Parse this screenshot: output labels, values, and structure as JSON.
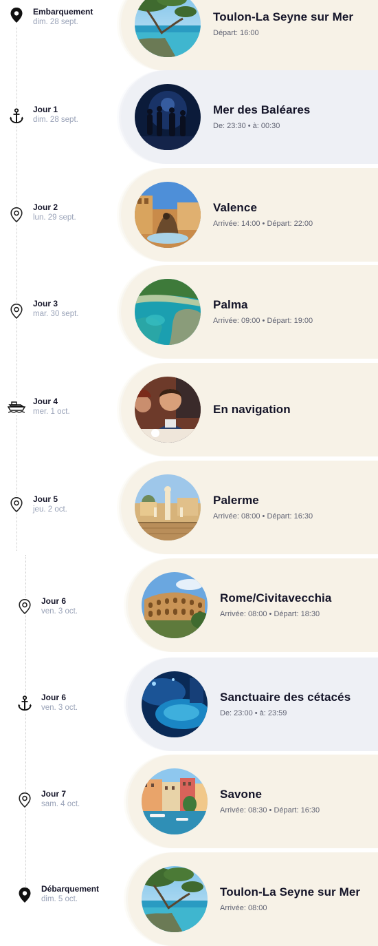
{
  "stops": [
    {
      "icon": "pin-filled",
      "kind": "port",
      "day": "Embarquement",
      "date": "dim. 28 sept.",
      "title": "Toulon-La Seyne sur Mer",
      "times": "Départ: 16:00",
      "photo": "coast-pine"
    },
    {
      "icon": "anchor",
      "kind": "sea",
      "day": "Jour 1",
      "date": "dim. 28 sept.",
      "title": "Mer des Baléares",
      "times": "De: 23:30 • à: 00:30",
      "photo": "night-show"
    },
    {
      "icon": "pin-outline",
      "kind": "port",
      "day": "Jour 2",
      "date": "lun. 29 sept.",
      "title": "Valence",
      "times": "Arrivée: 14:00 • Départ: 22:00",
      "photo": "valence"
    },
    {
      "icon": "pin-outline",
      "kind": "port",
      "day": "Jour 3",
      "date": "mar. 30 sept.",
      "title": "Palma",
      "times": "Arrivée: 09:00 • Départ: 19:00",
      "photo": "palma"
    },
    {
      "icon": "ship",
      "kind": "port",
      "day": "Jour 4",
      "date": "mer. 1 oct.",
      "title": "En navigation",
      "times": "",
      "photo": "dining"
    },
    {
      "icon": "pin-outline",
      "kind": "port",
      "day": "Jour 5",
      "date": "jeu. 2 oct.",
      "title": "Palerme",
      "times": "Arrivée: 08:00 • Départ: 16:30",
      "photo": "palerme"
    },
    {
      "icon": "pin-outline",
      "kind": "port",
      "day": "Jour 6",
      "date": "ven. 3 oct.",
      "title": "Rome/Civitavecchia",
      "times": "Arrivée: 08:00 • Départ: 18:30",
      "photo": "colosseum"
    },
    {
      "icon": "anchor",
      "kind": "sea",
      "day": "Jour 6",
      "date": "ven. 3 oct.",
      "title": "Sanctuaire des cétacés",
      "times": "De: 23:00 • à: 23:59",
      "photo": "pool-night"
    },
    {
      "icon": "pin-outline",
      "kind": "port",
      "day": "Jour 7",
      "date": "sam. 4 oct.",
      "title": "Savone",
      "times": "Arrivée: 08:30 • Départ: 16:30",
      "photo": "savone"
    },
    {
      "icon": "pin-filled",
      "kind": "port",
      "day": "Débarquement",
      "date": "dim. 5 oct.",
      "title": "Toulon-La Seyne sur Mer",
      "times": "Arrivée: 08:00",
      "photo": "coast-pine"
    }
  ],
  "colors": {
    "port": "#f7f2e7",
    "sea": "#eef0f5",
    "title": "#141428",
    "date": "#9aa3b8"
  }
}
